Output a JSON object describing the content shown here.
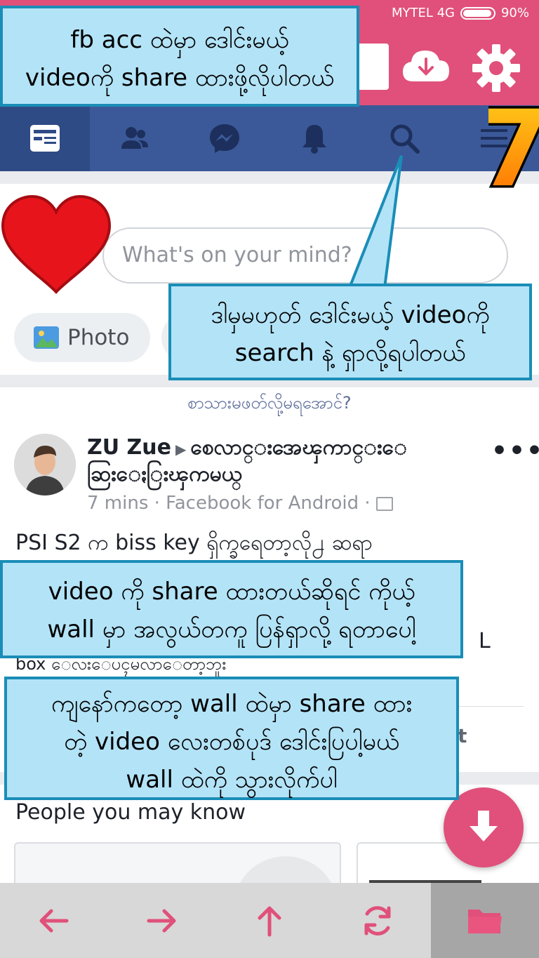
{
  "status_bar": {
    "carrier": "MYTEL 4G",
    "battery": "90%"
  },
  "app_bar": {
    "icons": [
      "cloud-download-icon",
      "gear-icon"
    ]
  },
  "fb_nav": {
    "tabs": [
      "news-feed-icon",
      "friends-icon",
      "messenger-icon",
      "bell-icon",
      "search-icon",
      "menu-icon"
    ]
  },
  "composer": {
    "placeholder": "What's on your mind?",
    "photo_label": "Photo"
  },
  "post": {
    "suggestion": "စာသားမဖတ်လို့မရအောင်?",
    "author": "ZU Zue",
    "group": "စေလာင္းအေၾကာင္းေ ဆြးေႏြးၾကမယ္",
    "meta": "7 mins · Facebook for Android ·",
    "text": "PSI S2 က biss key ရှိက္ခရေတာ့လို႕ ဆရာ",
    "text_tail": "box ေလးေပၚမလာေတာ့ဘူး",
    "text_suffix": "L",
    "more": "•••",
    "action_fragment": "t"
  },
  "people": {
    "heading": "People you may know"
  },
  "bottom_bar": {
    "icons": [
      "back-arrow-icon",
      "forward-arrow-icon",
      "up-arrow-icon",
      "refresh-icon",
      "folder-icon"
    ]
  },
  "annotations": {
    "step_number": "7",
    "callout1": [
      "fb acc ထဲမှာ ဒေါင်းမယ့်",
      "videoကို share ထားဖို့လိုပါတယ်"
    ],
    "callout2": [
      "ဒါမှမဟုတ် ဒေါင်းမယ့် videoကို",
      "search နဲ့ ရှာလို့ရပါတယ်"
    ],
    "callout3": [
      "video ကို share ထားတယ်ဆိုရင် ကိုယ့်",
      "wall မှာ အလွယ်တကူ ပြန်ရှာလို့ ရတာပေါ့"
    ],
    "callout4": [
      "ကျနော်ကတော့ wall ထဲမှာ share ထား",
      "တဲ့ video လေးတစ်ပုဒ် ဒေါင်းပြပါ့မယ်",
      "wall ထဲကို သွားလိုက်ပါ"
    ]
  },
  "colors": {
    "app_pink": "#e0507a",
    "fb_blue": "#3b5998",
    "callout_bg": "#b3e3f7",
    "callout_border": "#1a8db7"
  }
}
